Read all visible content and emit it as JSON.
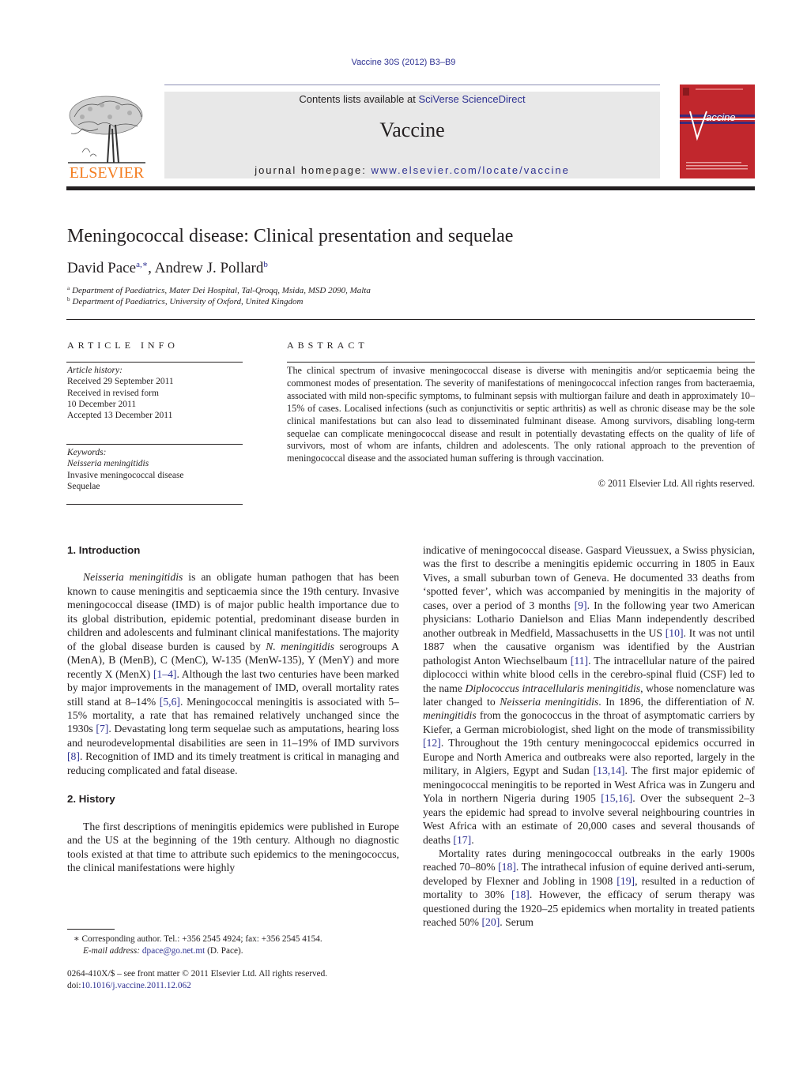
{
  "header": {
    "running_head": "Vaccine 30S (2012) B3–B9",
    "contents_prefix": "Contents lists available at ",
    "contents_link": "SciVerse ScienceDirect",
    "journal_name": "Vaccine",
    "homepage_prefix": "journal homepage: ",
    "homepage_link": "www.elsevier.com/locate/vaccine",
    "publisher_logo_text": "ELSEVIER",
    "cover_title": "Vaccine",
    "colors": {
      "link": "#2e3192",
      "publisher_orange": "#f47d20",
      "cover_red": "#c1272d",
      "banner_gray": "#e8e8e8"
    }
  },
  "article": {
    "title": "Meningococcal disease: Clinical presentation and sequelae",
    "authors": [
      {
        "name": "David Pace",
        "marks": "a,∗"
      },
      {
        "name": "Andrew J. Pollard",
        "marks": "b"
      }
    ],
    "author_separator": ", ",
    "affiliations": [
      {
        "mark": "a",
        "text": "Department of Paediatrics, Mater Dei Hospital, Tal-Qroqq, Msida, MSD 2090, Malta"
      },
      {
        "mark": "b",
        "text": "Department of Paediatrics, University of Oxford, United Kingdom"
      }
    ]
  },
  "article_info": {
    "heading": "ARTICLE INFO",
    "history_label": "Article history:",
    "history": [
      "Received 29 September 2011",
      "Received in revised form",
      "10 December 2011",
      "Accepted 13 December 2011"
    ],
    "keywords_label": "Keywords:",
    "keywords": [
      {
        "text": "Neisseria meningitidis",
        "italic": true
      },
      {
        "text": "Invasive meningococcal disease",
        "italic": false
      },
      {
        "text": "Sequelae",
        "italic": false
      }
    ]
  },
  "abstract": {
    "heading": "ABSTRACT",
    "text": "The clinical spectrum of invasive meningococcal disease is diverse with meningitis and/or septicaemia being the commonest modes of presentation. The severity of manifestations of meningococcal infection ranges from bacteraemia, associated with mild non-specific symptoms, to fulminant sepsis with multiorgan failure and death in approximately 10–15% of cases. Localised infections (such as conjunctivitis or septic arthritis) as well as chronic disease may be the sole clinical manifestations but can also lead to disseminated fulminant disease. Among survivors, disabling long-term sequelae can complicate meningococcal disease and result in potentially devastating effects on the quality of life of survivors, most of whom are infants, children and adolescents. The only rational approach to the prevention of meningococcal disease and the associated human suffering is through vaccination.",
    "copyright": "© 2011 Elsevier Ltd. All rights reserved."
  },
  "body": {
    "intro_heading": "1.  Introduction",
    "intro": {
      "s1_it": "Neisseria meningitidis",
      "s1": " is an obligate human pathogen that has been known to cause meningitis and septicaemia since the 19th century. Invasive meningococcal disease (IMD) is of major public health importance due to its global distribution, epidemic potential, predominant disease burden in children and adolescents and fulminant clinical manifestations. The majority of the global disease burden is caused by ",
      "s2_it": "N. meningitidis",
      "s2": " serogroups A (MenA), B (MenB), C (MenC), W-135 (MenW-135), Y (MenY) and more recently X (MenX) ",
      "r1": "[1–4]",
      "s3": ". Although the last two centuries have been marked by major improvements in the management of IMD, overall mortality rates still stand at 8–14% ",
      "r2": "[5,6]",
      "s4": ". Meningococcal meningitis is associated with 5–15% mortality, a rate that has remained relatively unchanged since the 1930s ",
      "r3": "[7]",
      "s5": ". Devastating long term sequelae such as amputations, hearing loss and neurodevelopmental disabilities are seen in 11–19% of IMD survivors ",
      "r4": "[8]",
      "s6": ". Recognition of IMD and its timely treatment is critical in managing and reducing complicated and fatal disease."
    },
    "history_heading": "2.  History",
    "history_p1": "The first descriptions of meningitis epidemics were published in Europe and the US at the beginning of the 19th century. Although no diagnostic tools existed at that time to attribute such epidemics to the meningococcus, the clinical manifestations were highly",
    "right": {
      "a1": "indicative of meningococcal disease. Gaspard Vieussuex, a Swiss physician, was the first to describe a meningitis epidemic occurring in 1805 in Eaux Vives, a small suburban town of Geneva. He documented 33 deaths from ‘spotted fever’, which was accompanied by meningitis in the majority of cases, over a period of 3 months ",
      "r9": "[9]",
      "a2": ". In the following year two American physicians: Lothario Danielson and Elias Mann independently described another outbreak in Medfield, Massachusetts in the US ",
      "r10": "[10]",
      "a3": ". It was not until 1887 when the causative organism was identified by the Austrian pathologist Anton Wiechselbaum ",
      "r11": "[11]",
      "a4": ". The intracellular nature of the paired diplococci within white blood cells in the cerebro-spinal fluid (CSF) led to the name ",
      "a4_it": "Diplococcus intracellularis meningitidis",
      "a5": ", whose nomenclature was later changed to ",
      "a5_it": "Neisseria meningitidis",
      "a6": ". In 1896, the differentiation of ",
      "a6_it": "N. meningitidis",
      "a7": " from the gonococcus in the throat of asymptomatic carriers by Kiefer, a German microbiologist, shed light on the mode of transmissibility ",
      "r12": "[12]",
      "a8": ". Throughout the 19th century meningococcal epidemics occurred in Europe and North America and outbreaks were also reported, largely in the military, in Algiers, Egypt and Sudan ",
      "r13": "[13,14]",
      "a9": ". The first major epidemic of meningococcal meningitis to be reported in West Africa was in Zungeru and Yola in northern Nigeria during 1905 ",
      "r15": "[15,16]",
      "a10": ". Over the subsequent 2–3 years the epidemic had spread to involve several neighbouring countries in West Africa with an estimate of 20,000 cases and several thousands of deaths ",
      "r17": "[17]",
      "a11": ".",
      "b1": "Mortality rates during meningococcal outbreaks in the early 1900s reached 70–80% ",
      "r18a": "[18]",
      "b2": ". The intrathecal infusion of equine derived anti-serum, developed by Flexner and Jobling in 1908 ",
      "r19": "[19]",
      "b3": ", resulted in a reduction of mortality to 30% ",
      "r18b": "[18]",
      "b4": ". However, the efficacy of serum therapy was questioned during the 1920–25 epidemics when mortality in treated patients reached 50% ",
      "r20": "[20]",
      "b5": ". Serum"
    }
  },
  "footnote": {
    "mark": "∗",
    "corresponding": " Corresponding author. Tel.: +356 2545 4924; fax: +356 2545 4154.",
    "email_label": "E-mail address:",
    "email": "dpace@go.net.mt",
    "email_suffix": " (D. Pace)."
  },
  "front_matter": {
    "issn_line": "0264-410X/$ – see front matter © 2011 Elsevier Ltd. All rights reserved.",
    "doi_prefix": "doi:",
    "doi": "10.1016/j.vaccine.2011.12.062"
  }
}
